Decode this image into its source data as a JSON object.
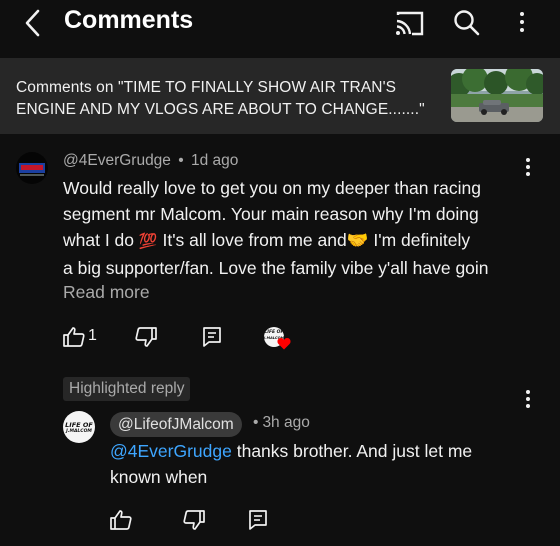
{
  "header": {
    "title": "Comments"
  },
  "video": {
    "line1": "Comments on \"TIME TO FINALLY SHOW AIR TRAN'S",
    "line2": "ENGINE AND MY VLOGS ARE ABOUT TO CHANGE.......\""
  },
  "comment": {
    "author": "@4EverGrudge",
    "time": "1d ago",
    "lines": [
      "Would really love to get you on my deeper than racing",
      "segment mr Malcom. Your main reason why I'm doing",
      "what I do",
      "It's all love from me and",
      "I'm definitely",
      "a big supporter/fan. Love the family vibe y'all have goin"
    ],
    "emoji_100": "💯",
    "emoji_hands": "🤝",
    "read_more": "Read more",
    "like_count": "1"
  },
  "reply": {
    "badge": "Highlighted reply",
    "author": "@LifeofJMalcom",
    "time": "3h ago",
    "mention": "@4EverGrudge",
    "line1_rest": " thanks brother. And just let me",
    "line2": "known when"
  },
  "logos": {
    "small_text_top": "LIFE OF",
    "small_text_bottom": "J.MALCOM"
  },
  "colors": {
    "background": "#0f0f0f",
    "banner": "#272727",
    "mention": "#3ea6ff",
    "heart": "#ff0000"
  }
}
